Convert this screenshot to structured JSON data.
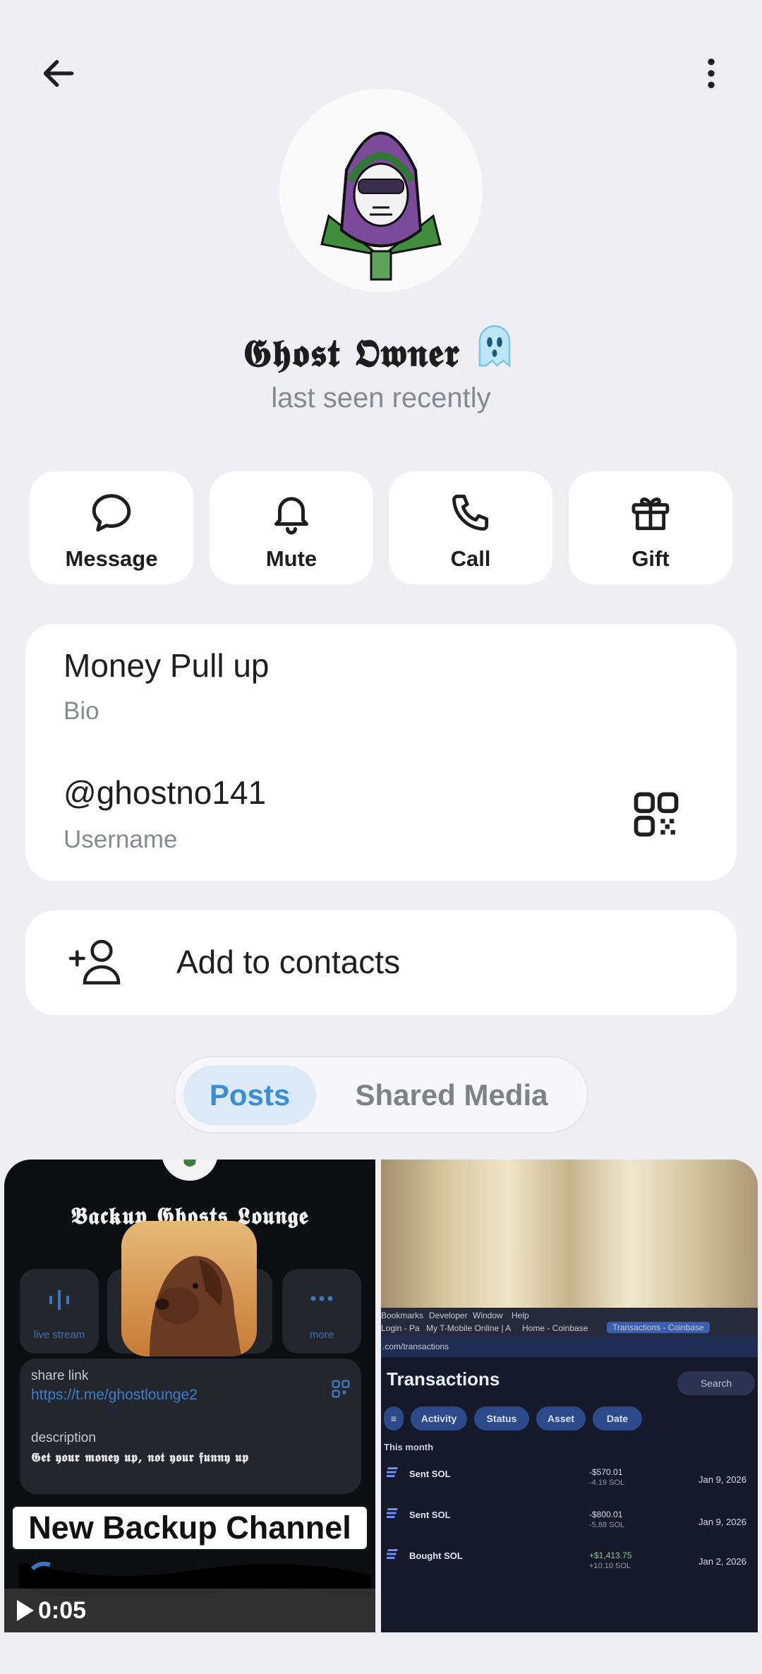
{
  "header": {
    "back_icon": "arrow-left-icon",
    "more_icon": "kebab-menu-icon"
  },
  "profile": {
    "name": "𝕲𝖍𝖔𝖘𝖙 𝕺𝖜𝖓𝖊𝖗",
    "name_emoji": "ghost-icon",
    "status": "last seen recently"
  },
  "actions": [
    {
      "label": "Message",
      "icon": "chat-bubble-icon"
    },
    {
      "label": "Mute",
      "icon": "bell-icon"
    },
    {
      "label": "Call",
      "icon": "phone-icon"
    },
    {
      "label": "Gift",
      "icon": "gift-icon"
    }
  ],
  "info": {
    "bio_value": "Money Pull up",
    "bio_label": "Bio",
    "username_value": "@ghostno141",
    "username_label": "Username",
    "qr_icon": "qr-code-icon"
  },
  "contacts": {
    "label": "Add to contacts",
    "icon": "add-person-icon"
  },
  "tabs": [
    {
      "label": "Posts",
      "active": true
    },
    {
      "label": "Shared Media",
      "active": false
    }
  ],
  "posts": [
    {
      "title": "𝕭𝖆𝖈𝖐𝖚𝖕 𝕲𝖍𝖔𝖘𝖙𝖘 𝕷𝖔𝖚𝖓𝖌𝖊",
      "btn_left": "live stream",
      "btn_right": "more",
      "share_label": "share link",
      "share_link": "https://t.me/ghostlounge2",
      "desc_label": "description",
      "desc_value": "𝕲𝖊𝖙 𝖞𝖔𝖚𝖗 𝖒𝖔𝖓𝖊𝖞 𝖚𝖕, 𝖓𝖔𝖙 𝖞𝖔𝖚𝖗 𝖋𝖚𝖓𝖓𝖞 𝖚𝖕",
      "banner": "New Backup Channel",
      "video_time": "0:05"
    },
    {
      "browser_tabs": [
        "Bookmarks",
        "Developer",
        "Window",
        "Help"
      ],
      "tab_text": "My T-Mobile Online | A",
      "tab_text2": "Home - Coinbase",
      "tab_active": "Transactions - Coinbase",
      "tab_left": "Login - Pa",
      "url": ".com/transactions",
      "heading": "Transactions",
      "search": "Search",
      "chips": [
        "Activity",
        "Status",
        "Asset",
        "Date"
      ],
      "month": "This month",
      "rows": [
        {
          "name": "Sent SOL",
          "amount": "-$570.01",
          "sub": "-4.19 SOL",
          "date": "Jan 9, 2026"
        },
        {
          "name": "Sent SOL",
          "amount": "-$800.01",
          "sub": "-5.88 SOL",
          "date": "Jan 9, 2026"
        },
        {
          "name": "Bought SOL",
          "amount": "+$1,413.75",
          "sub": "+10.10 SOL",
          "date": "Jan 2, 2026"
        }
      ]
    }
  ]
}
